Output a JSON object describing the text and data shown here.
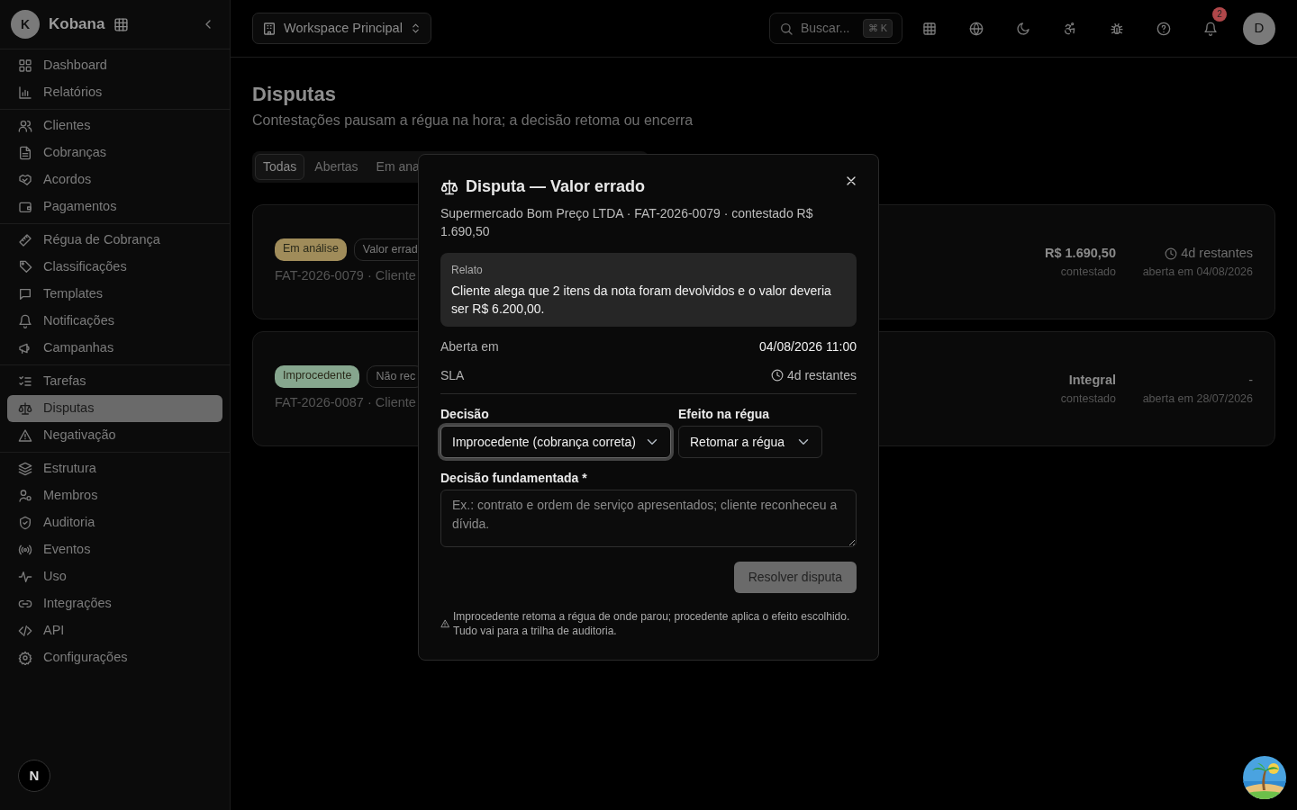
{
  "sidebar": {
    "org": {
      "initial": "K",
      "name": "Kobana"
    },
    "groups": [
      {
        "items": [
          {
            "label": "Dashboard",
            "selected": false
          },
          {
            "label": "Relatórios",
            "selected": false
          }
        ]
      },
      {
        "items": [
          {
            "label": "Clientes",
            "selected": false
          },
          {
            "label": "Cobranças",
            "selected": false
          },
          {
            "label": "Acordos",
            "selected": false
          },
          {
            "label": "Pagamentos",
            "selected": false
          }
        ]
      },
      {
        "items": [
          {
            "label": "Régua de Cobrança",
            "selected": false
          },
          {
            "label": "Classificações",
            "selected": false
          },
          {
            "label": "Templates",
            "selected": false
          },
          {
            "label": "Notificações",
            "selected": false
          },
          {
            "label": "Campanhas",
            "selected": false
          }
        ]
      },
      {
        "items": [
          {
            "label": "Tarefas",
            "selected": false
          },
          {
            "label": "Disputas",
            "selected": true
          },
          {
            "label": "Negativação",
            "selected": false
          }
        ]
      },
      {
        "items": [
          {
            "label": "Estrutura",
            "selected": false
          },
          {
            "label": "Membros",
            "selected": false
          },
          {
            "label": "Auditoria",
            "selected": false
          },
          {
            "label": "Eventos",
            "selected": false
          },
          {
            "label": "Uso",
            "selected": false
          },
          {
            "label": "Integrações",
            "selected": false
          },
          {
            "label": "API",
            "selected": false
          },
          {
            "label": "Configurações",
            "selected": false
          }
        ]
      }
    ],
    "dev_badge": "N"
  },
  "topbar": {
    "workspace": "Workspace Principal",
    "search": {
      "placeholder": "Buscar...",
      "shortcut": "⌘ K"
    },
    "notifications": {
      "count": "2"
    },
    "user": {
      "initial": "D"
    }
  },
  "page": {
    "title": "Disputas",
    "subtitle": "Contestações pausam a régua na hora; a decisão retoma ou encerra"
  },
  "tabs": [
    {
      "label": "Todas",
      "selected": true
    },
    {
      "label": "Abertas",
      "selected": false
    },
    {
      "label": "Em ana",
      "selected": false
    }
  ],
  "disputes": [
    {
      "status": "Em análise",
      "color": "#a08c5a",
      "reason": "Valor errad",
      "ref": "FAT-2026-0079 · Cliente",
      "amount": "R$ 1.690,50",
      "amount_note": "contestado",
      "sla_running": true,
      "sla": "4d restantes",
      "opened": "aberta em 04/08/2026"
    },
    {
      "status": "Improcedente",
      "color": "#86a68e",
      "reason": "Não rec",
      "ref": "FAT-2026-0087 · Cliente",
      "amount": "Integral",
      "amount_note": "contestado",
      "sla_running": false,
      "sla": "-",
      "opened": "aberta em 28/07/2026"
    }
  ],
  "modal": {
    "title": "Disputa — Valor errado",
    "subtitle": "Supermercado Bom Preço LTDA · FAT-2026-0079 · contestado R$ 1.690,50",
    "report": {
      "label": "Relato",
      "text": "Cliente alega que 2 itens da nota foram devolvidos e o valor deveria ser R$ 6.200,00."
    },
    "details": [
      {
        "kind": "text",
        "label": "Aberta em",
        "value": "04/08/2026 11:00"
      },
      {
        "kind": "timer",
        "label": "SLA",
        "value": "4d restantes"
      }
    ],
    "decision": {
      "label": "Decisão",
      "value": "Improcedente (cobrança correta)",
      "focused": true
    },
    "effect": {
      "label": "Efeito na régua",
      "value": "Retomar a régua",
      "focused": false
    },
    "justification": {
      "label": "Decisão fundamentada *",
      "placeholder": "Ex.: contrato e ordem de serviço apresentados; cliente reconheceu a dívida."
    },
    "submit": {
      "label": "Resolver disputa",
      "disabled": true
    },
    "note": "Improcedente retoma a régua de onde parou; procedente aplica o efeito escolhido. Tudo vai para a trilha de auditoria."
  }
}
